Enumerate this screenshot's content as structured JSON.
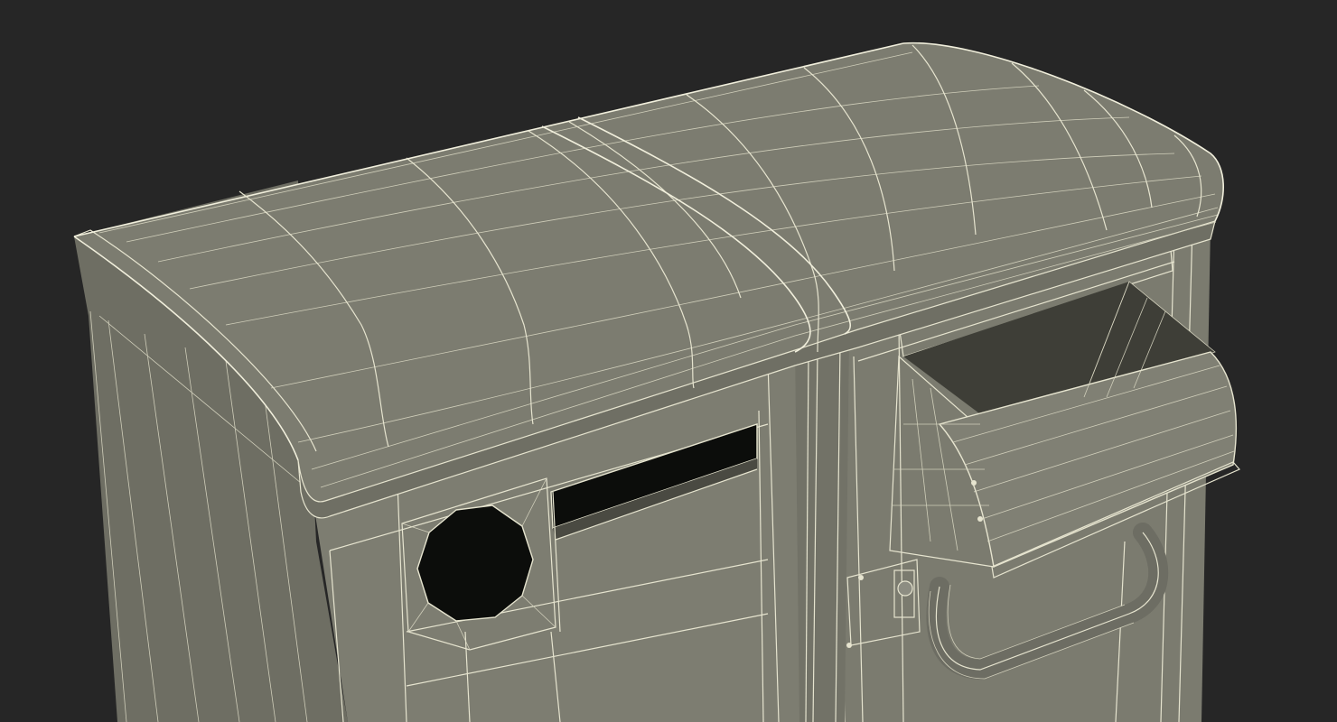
{
  "scene": {
    "subject": "recycling-bin-wireframe-render",
    "colors": {
      "background": "#262626",
      "surface": "#7a7a6e",
      "surface_light": "#8a8a7d",
      "surface_dark": "#5e5e54",
      "wireframe": "#e6e4cf",
      "opening": "#0c0d0b"
    }
  }
}
